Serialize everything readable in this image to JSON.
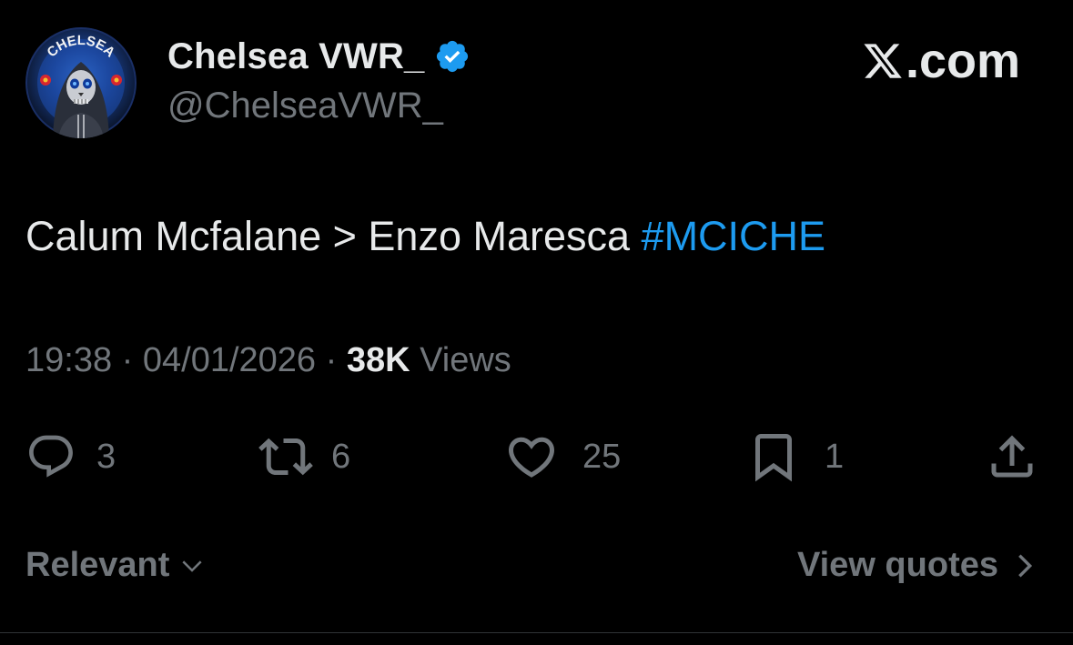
{
  "author": {
    "display_name": "Chelsea VWR_",
    "handle": "@ChelseaVWR_",
    "avatar_text": "CHELSEA",
    "verified": true,
    "avatar_icon": "chelsea-skull-avatar"
  },
  "brand": {
    "logo_icon": "x-logo-icon",
    "label": ".com"
  },
  "tweet": {
    "text_plain": "Calum Mcfalane > Enzo Maresca ",
    "hashtag": "#MCICHE"
  },
  "meta": {
    "time": "19:38",
    "sep1": " · ",
    "date": "04/01/2026",
    "sep2": " · ",
    "views_count": "38K",
    "views_label": " Views"
  },
  "actions": {
    "replies": "3",
    "reposts": "6",
    "likes": "25",
    "bookmarks": "1"
  },
  "footer": {
    "sort_label": "Relevant",
    "view_quotes_label": "View quotes"
  },
  "colors": {
    "background": "#000000",
    "primary_text": "#e7e9ea",
    "secondary_text": "#71767b",
    "accent": "#1d9bf0",
    "divider": "#2f3336"
  }
}
